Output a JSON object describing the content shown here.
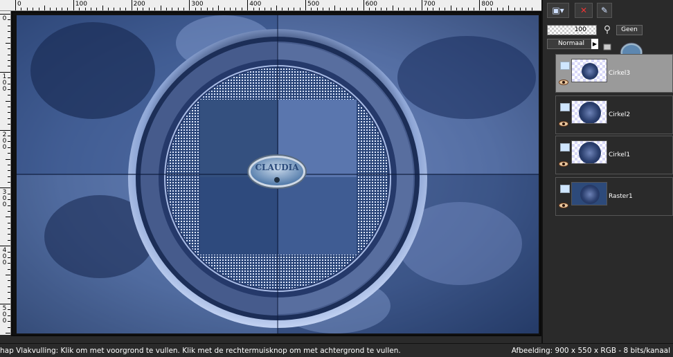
{
  "ruler": {
    "top_labels": [
      "0",
      "100",
      "200",
      "300",
      "400",
      "500",
      "600",
      "700",
      "800"
    ],
    "left_labels": [
      [
        "0"
      ],
      [
        "1",
        "0",
        "0"
      ],
      [
        "2",
        "0",
        "0"
      ],
      [
        "3",
        "0",
        "0"
      ],
      [
        "4",
        "0",
        "0"
      ],
      [
        "5",
        "0",
        "0"
      ]
    ]
  },
  "canvas": {
    "watermark_text": "CLAUDIA",
    "colors": {
      "deep": "#17284e",
      "mid": "#3f5c90",
      "light": "#8ea6d6",
      "pale": "#c2d2f2"
    }
  },
  "toolbar": {
    "icons": [
      "new-layer-icon",
      "delete-layer-icon",
      "layer-tools-icon"
    ]
  },
  "properties": {
    "opacity": "100",
    "mask_label": "Geen",
    "blend_mode": "Normaal"
  },
  "layers": [
    {
      "name": "Cirkel3",
      "active": true
    },
    {
      "name": "Cirkel2",
      "active": false
    },
    {
      "name": "Cirkel1",
      "active": false
    },
    {
      "name": "Raster1",
      "active": false
    }
  ],
  "status": {
    "hint": "hap Vlakvulling: Klik om met voorgrond te vullen. Klik met de rechtermuisknop om met achtergrond te vullen.",
    "image_info": "Afbeelding:  900 x 550 x RGB - 8 bits/kanaal"
  }
}
